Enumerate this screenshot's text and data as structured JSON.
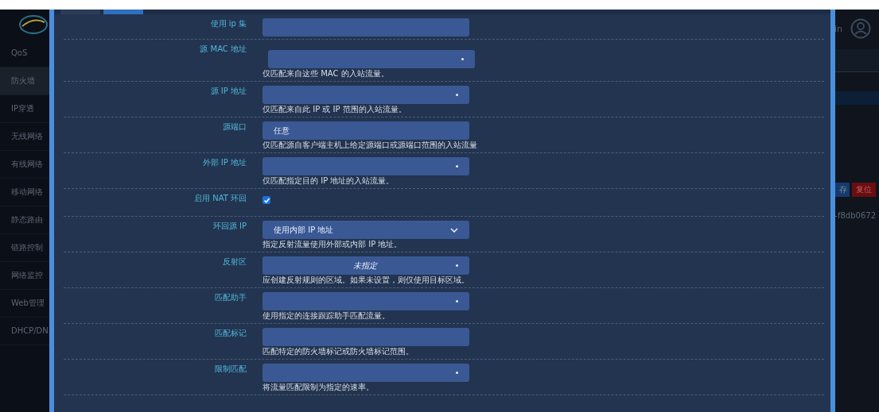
{
  "sidebar": {
    "items": [
      {
        "label": "QoS",
        "selected": false
      },
      {
        "label": "防火墙",
        "selected": true
      },
      {
        "label": "IP穿透",
        "selected": false
      },
      {
        "label": "无线网络",
        "selected": false
      },
      {
        "label": "有线网络",
        "selected": false
      },
      {
        "label": "移动网络",
        "selected": false
      },
      {
        "label": "静态路由",
        "selected": false
      },
      {
        "label": "链路控制",
        "selected": false
      },
      {
        "label": "网络监控",
        "selected": false
      },
      {
        "label": "Web管理",
        "selected": false
      },
      {
        "label": "DHCP/DN",
        "selected": false
      }
    ]
  },
  "header": {
    "user": "in"
  },
  "page_buttons": [
    {
      "label": "存",
      "kind": "primary"
    },
    {
      "label": "复位",
      "kind": "danger"
    }
  ],
  "page_id": "-f8db0672",
  "modal": {
    "tabs": [
      {
        "selected": false
      },
      {
        "selected": true
      }
    ],
    "fields": [
      {
        "kind": "text",
        "label": "使用 ip 集"
      },
      {
        "kind": "dynlist",
        "label": "源 MAC 地址",
        "help": "仅匹配来自这些 MAC 的入站流量。"
      },
      {
        "kind": "dropdown",
        "label": "源 IP 地址",
        "help": "仅匹配来自此 IP 或 IP 范围的入站流量。"
      },
      {
        "kind": "text",
        "label": "源端口",
        "value": "任意",
        "help": "仅匹配源自客户端主机上给定源端口或源端口范围的入站流量"
      },
      {
        "kind": "dropdown",
        "label": "外部 IP 地址",
        "help": "仅匹配指定目的 IP 地址的入站流量。"
      },
      {
        "kind": "checkbox",
        "label": "启用 NAT 环回",
        "checked": true
      },
      {
        "kind": "select",
        "label": "环回源 IP",
        "value": "使用内部 IP 地址",
        "help": "指定反射流量使用外部或内部 IP 地址。"
      },
      {
        "kind": "dropdown",
        "label": "反射区",
        "value": "未指定",
        "help": "应创建反射规则的区域。如果未设置，则仅使用目标区域。"
      },
      {
        "kind": "dropdown",
        "label": "匹配助手",
        "help": "使用指定的连接跟踪助手匹配流量。"
      },
      {
        "kind": "text",
        "label": "匹配标记",
        "help": "匹配特定的防火墙标记或防火墙标记范围。"
      },
      {
        "kind": "dropdown",
        "label": "限制匹配",
        "help": "将流量匹配限制为指定的速率。"
      }
    ]
  }
}
